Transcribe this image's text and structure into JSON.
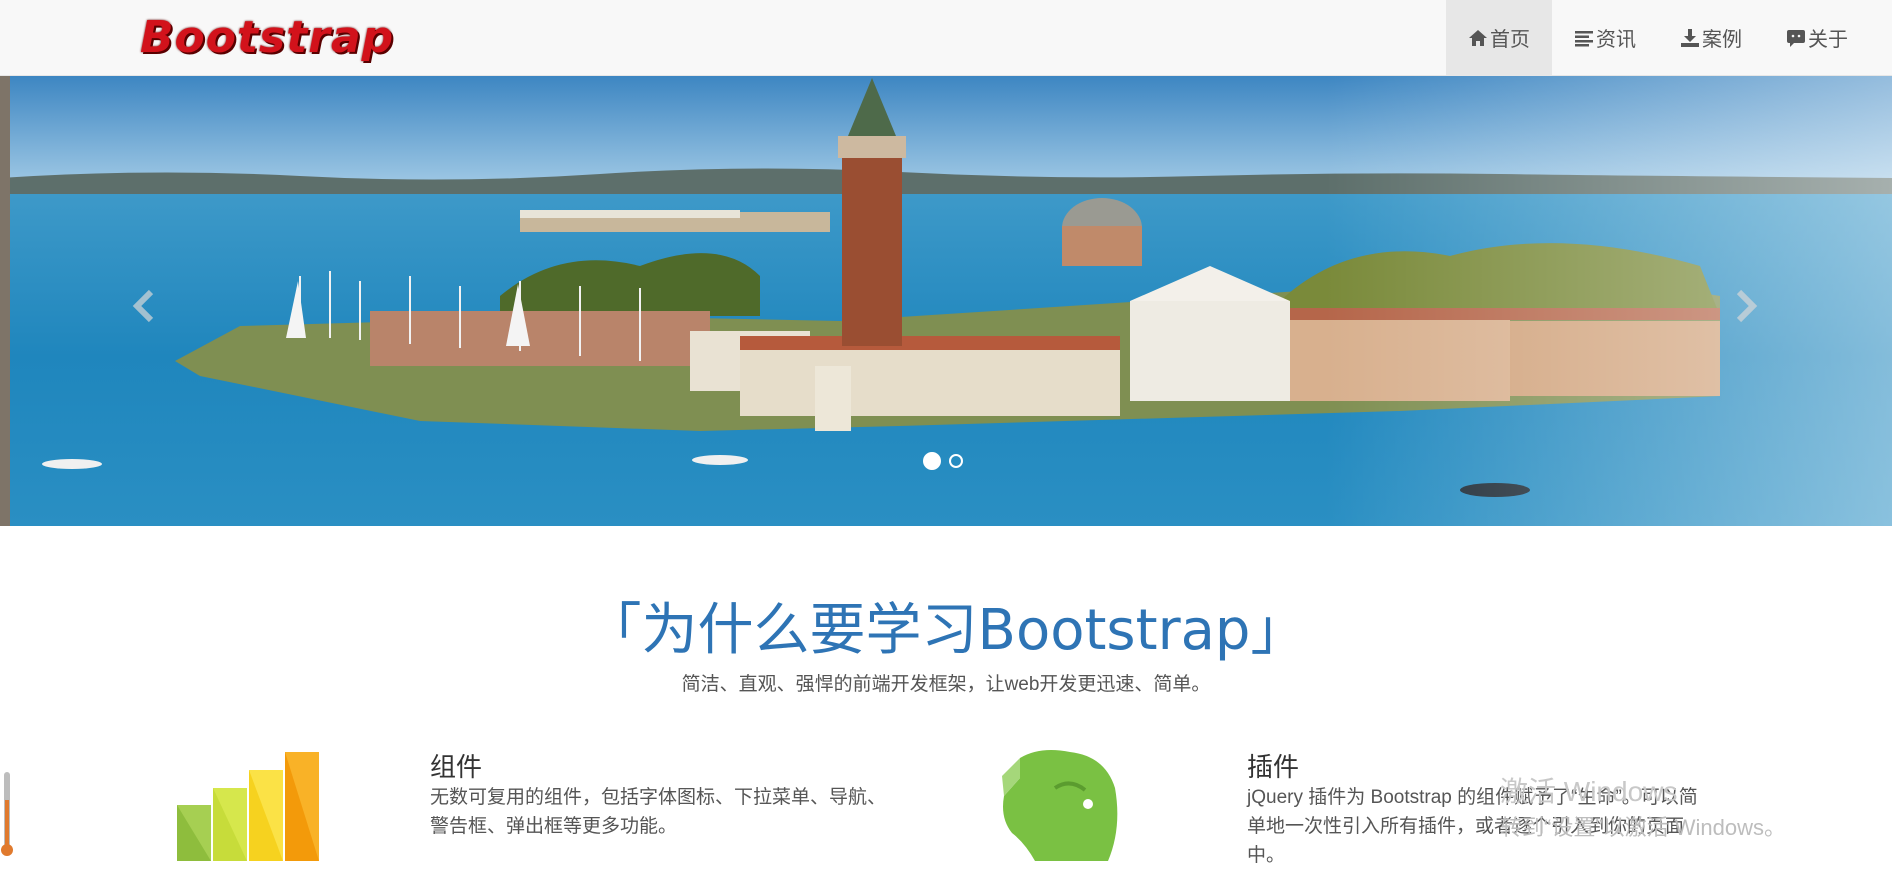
{
  "brand": {
    "name": "Bootstrap",
    "color": "#d2121b"
  },
  "nav": {
    "items": [
      {
        "label": "首页",
        "icon": "home-icon",
        "active": true
      },
      {
        "label": "资讯",
        "icon": "list-icon",
        "active": false
      },
      {
        "label": "案例",
        "icon": "download-icon",
        "active": false
      },
      {
        "label": "关于",
        "icon": "chat-icon",
        "active": false
      }
    ]
  },
  "carousel": {
    "slide": "venice-island-photo",
    "indicators": [
      "slide-1",
      "slide-2"
    ],
    "active_index": 0
  },
  "why": {
    "title": "「为什么要学习Bootstrap」",
    "subtitle": "简洁、直观、强悍的前端开发框架，让web开发更迅速、简单。"
  },
  "features": [
    {
      "title": "组件",
      "desc_line1": "无数可复用的组件，包括字体图标、下拉菜单、导航、",
      "desc_line2": "警告框、弹出框等更多功能。",
      "icon": "bar-chart-icon"
    },
    {
      "title": "插件",
      "desc_line1": "jQuery 插件为 Bootstrap 的组件赋予了“生命”。可以简",
      "desc_line2": "单地一次性引入所有插件，或者逐个引入到你的页面",
      "desc_line3": "中。",
      "icon": "evernote-elephant-icon"
    }
  ],
  "watermark": {
    "line1": "激活 Windows",
    "line2": "转到“设置”以激活 Windows。"
  },
  "colors": {
    "title_blue": "#2e74b5",
    "navbar_bg": "#f8f8f8",
    "nav_active_bg": "#e7e7e7"
  }
}
